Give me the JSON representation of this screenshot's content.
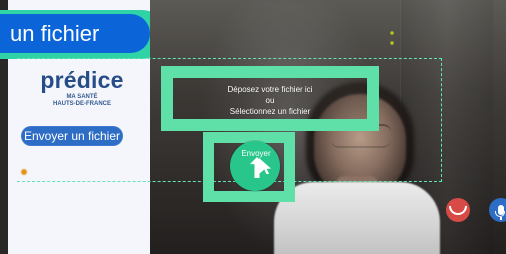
{
  "top_label": {
    "text": "un fichier"
  },
  "brand": {
    "name": "prédice",
    "tagline_line1": "MA SANTÉ",
    "tagline_line2": "HAUTS-DE-FRANCE"
  },
  "sidebar": {
    "send_button_label": "Envoyer un fichier"
  },
  "dropzone": {
    "line1": "Déposez votre fichier ici",
    "line2": "ou",
    "line3": "Sélectionnez un fichier"
  },
  "upload": {
    "button_label": "Envoyer"
  },
  "call_controls": {
    "hangup_icon": "hangup-icon",
    "mic_icon": "microphone-icon"
  },
  "icons": {
    "info_icon": "info-icon",
    "cursor_icon": "cursor-icon",
    "upload_arrow_icon": "upload-arrow-icon"
  },
  "colors": {
    "accent_green": "#5fe0a8",
    "brand_blue": "#0b65d9",
    "button_blue": "#2e6dc6",
    "send_green": "#28c68a",
    "hangup_red": "#d84a45"
  }
}
